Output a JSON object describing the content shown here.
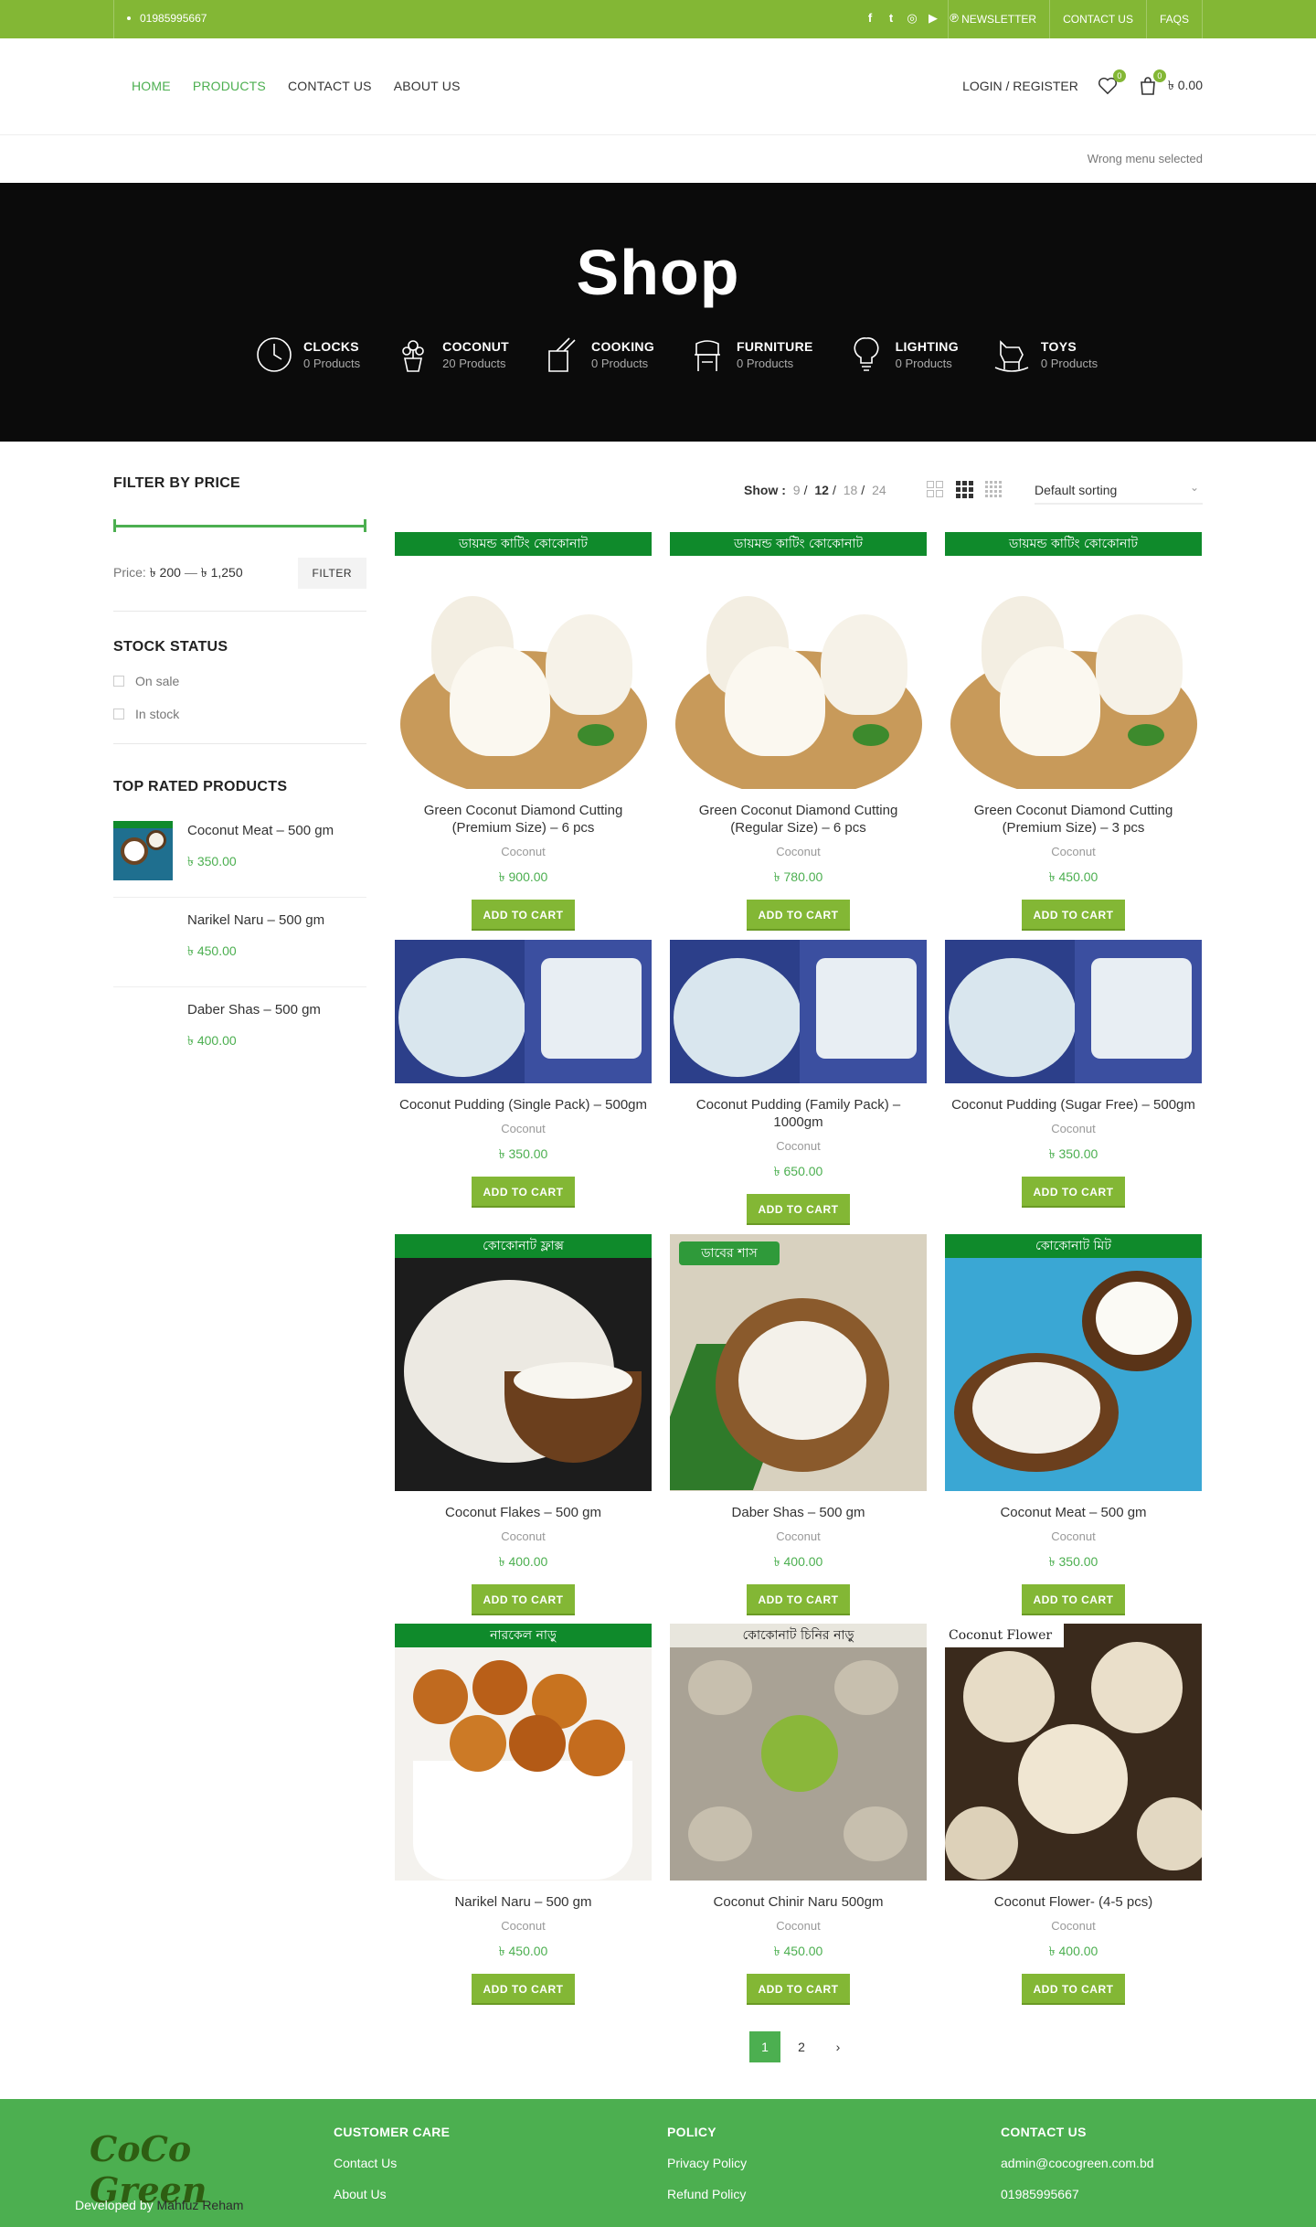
{
  "topbar": {
    "phone": "01985995667",
    "social_icons": [
      "facebook-icon",
      "twitter-icon",
      "instagram-icon",
      "youtube-icon",
      "pinterest-icon"
    ],
    "links": [
      "NEWSLETTER",
      "CONTACT US",
      "FAQS"
    ]
  },
  "header": {
    "nav": [
      "HOME",
      "PRODUCTS",
      "CONTACT US",
      "ABOUT US"
    ],
    "login": "LOGIN / REGISTER",
    "wishlist_count": "0",
    "cart_count": "0",
    "cart_total": "৳ 0.00",
    "wrong_menu": "Wrong menu selected"
  },
  "hero": {
    "title": "Shop",
    "categories": [
      {
        "name": "CLOCKS",
        "count": "0 Products"
      },
      {
        "name": "COCONUT",
        "count": "20 Products"
      },
      {
        "name": "COOKING",
        "count": "0 Products"
      },
      {
        "name": "FURNITURE",
        "count": "0 Products"
      },
      {
        "name": "LIGHTING",
        "count": "0 Products"
      },
      {
        "name": "TOYS",
        "count": "0 Products"
      }
    ]
  },
  "sidebar": {
    "filter_title": "FILTER BY PRICE",
    "price_label": "Price:",
    "price_min": "৳ 200",
    "price_sep": "—",
    "price_max": "৳ 1,250",
    "filter_button": "FILTER",
    "stock_title": "STOCK STATUS",
    "stock_options": [
      "On sale",
      "In stock"
    ],
    "top_rated_title": "TOP RATED PRODUCTS",
    "top_rated": [
      {
        "name": "Coconut Meat – 500 gm",
        "price": "৳ 350.00"
      },
      {
        "name": "Narikel Naru – 500 gm",
        "price": "৳ 450.00"
      },
      {
        "name": "Daber Shas – 500 gm",
        "price": "৳ 400.00"
      }
    ]
  },
  "toolbar": {
    "show_label": "Show :",
    "show_options": [
      "9",
      "12",
      "18",
      "24"
    ],
    "show_selected": "12",
    "sorting": "Default sorting"
  },
  "products": [
    {
      "name": "Green Coconut Diamond Cutting (Premium Size) – 6 pcs",
      "category": "Coconut",
      "price": "৳ 900.00",
      "banner": "ডায়মন্ড কাটিং কোকোনাট",
      "button": "ADD TO CART"
    },
    {
      "name": "Green Coconut Diamond Cutting (Regular Size) – 6 pcs",
      "category": "Coconut",
      "price": "৳ 780.00",
      "banner": "ডায়মন্ড কাটিং কোকোনাট",
      "button": "ADD TO CART"
    },
    {
      "name": "Green Coconut Diamond Cutting (Premium Size) – 3 pcs",
      "category": "Coconut",
      "price": "৳ 450.00",
      "banner": "ডায়মন্ড কাটিং কোকোনাট",
      "button": "ADD TO CART"
    },
    {
      "name": "Coconut Pudding (Single Pack) – 500gm",
      "category": "Coconut",
      "price": "৳ 350.00",
      "banner": "",
      "button": "ADD TO CART"
    },
    {
      "name": "Coconut Pudding (Family Pack) – 1000gm",
      "category": "Coconut",
      "price": "৳ 650.00",
      "banner": "",
      "button": "ADD TO CART"
    },
    {
      "name": "Coconut Pudding (Sugar Free) – 500gm",
      "category": "Coconut",
      "price": "৳ 350.00",
      "banner": "",
      "button": "ADD TO CART"
    },
    {
      "name": "Coconut Flakes – 500 gm",
      "category": "Coconut",
      "price": "৳ 400.00",
      "banner": "কোকোনাট ফ্লাক্স",
      "button": "ADD TO CART"
    },
    {
      "name": "Daber Shas – 500 gm",
      "category": "Coconut",
      "price": "৳ 400.00",
      "banner": "ডাবের শাস",
      "button": "ADD TO CART"
    },
    {
      "name": "Coconut Meat – 500 gm",
      "category": "Coconut",
      "price": "৳ 350.00",
      "banner": "কোকোনাট মিট",
      "button": "ADD TO CART"
    },
    {
      "name": "Narikel Naru – 500 gm",
      "category": "Coconut",
      "price": "৳ 450.00",
      "banner": "নারকেল নাড়ু",
      "button": "ADD TO CART"
    },
    {
      "name": "Coconut Chinir Naru 500gm",
      "category": "Coconut",
      "price": "৳ 450.00",
      "banner": "কোকোনাট চিনির নাড়ু",
      "button": "ADD TO CART"
    },
    {
      "name": "Coconut Flower- (4-5 pcs)",
      "category": "Coconut",
      "price": "৳ 400.00",
      "banner": "Coconut Flower",
      "button": "ADD TO CART"
    }
  ],
  "pagination": [
    "1",
    "2",
    "›"
  ],
  "footer": {
    "logo": "CoCo Green",
    "developed_by": "Developed by",
    "developer": "Mahfuz Reham",
    "columns": [
      {
        "title": "CUSTOMER CARE",
        "links": [
          "Contact Us",
          "About Us"
        ]
      },
      {
        "title": "POLICY",
        "links": [
          "Privacy Policy",
          "Refund Policy"
        ]
      },
      {
        "title": "CONTACT US",
        "links": [
          "admin@cocogreen.com.bd",
          "01985995667"
        ]
      }
    ]
  },
  "colors": {
    "accent": "#83b735",
    "green": "#4caf50",
    "banner_green": "#0f8a2b",
    "hero_bg": "#0b0b0b"
  }
}
